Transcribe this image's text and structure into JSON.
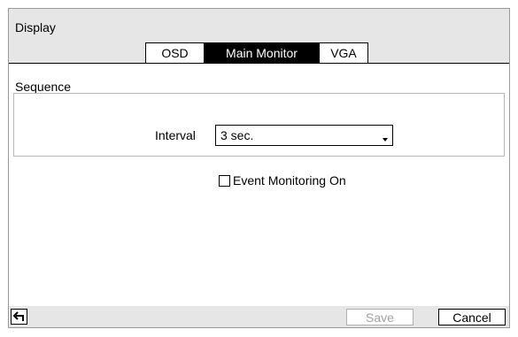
{
  "window": {
    "title": "Display"
  },
  "tabs": [
    {
      "label": "OSD",
      "active": false
    },
    {
      "label": "Main Monitor",
      "active": true
    },
    {
      "label": "VGA",
      "active": false
    }
  ],
  "sequence": {
    "section_label": "Sequence",
    "interval_label": "Interval",
    "interval_value": "3 sec."
  },
  "event_monitoring": {
    "label": "Event Monitoring On",
    "checked": false
  },
  "footer": {
    "save_label": "Save",
    "save_enabled": false,
    "cancel_label": "Cancel",
    "back_icon": "back-arrow-icon"
  },
  "colors": {
    "header_bg": "#e6e6e6",
    "active_tab_bg": "#000000",
    "active_tab_fg": "#ffffff",
    "disabled_text": "#a0a0a0"
  }
}
